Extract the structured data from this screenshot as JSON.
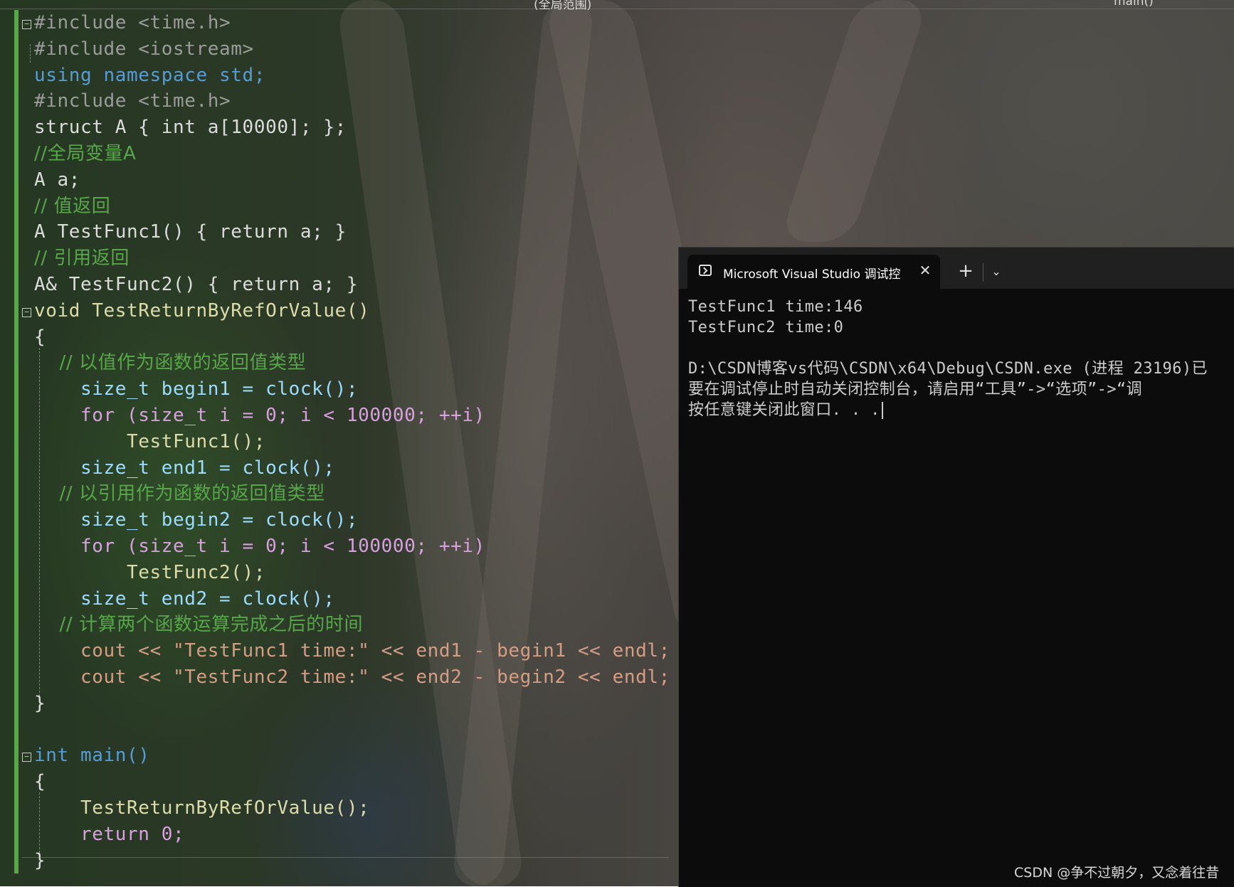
{
  "top_bar": {
    "scope_label": "(全局范围)",
    "function_label": "main()"
  },
  "editor": {
    "lines": [
      "#include <time.h>",
      "#include <iostream>",
      "using namespace std;",
      "#include <time.h>",
      "struct A { int a[10000]; };",
      "//全局变量A",
      "A a;",
      "// 值返回",
      "A TestFunc1() { return a; }",
      "// 引用返回",
      "A& TestFunc2() { return a; }",
      "void TestReturnByRefOrValue()",
      "{",
      "    // 以值作为函数的返回值类型",
      "    size_t begin1 = clock();",
      "    for (size_t i = 0; i < 100000; ++i)",
      "        TestFunc1();",
      "    size_t end1 = clock();",
      "    // 以引用作为函数的返回值类型",
      "    size_t begin2 = clock();",
      "    for (size_t i = 0; i < 100000; ++i)",
      "        TestFunc2();",
      "    size_t end2 = clock();",
      "    // 计算两个函数运算完成之后的时间",
      "    cout << \"TestFunc1 time:\" << end1 - begin1 << endl;",
      "    cout << \"TestFunc2 time:\" << end2 - begin2 << endl;",
      "}",
      "",
      "int main()",
      "{",
      "    TestReturnByRefOrValue();",
      "    return 0;",
      "}"
    ],
    "colors": {
      "keyword": "#569cd6",
      "control": "#d8a0df",
      "type": "#4ec9b0",
      "string": "#d69d85",
      "number": "#b5cea8",
      "comment": "#57a64a",
      "function": "#dcdcaa",
      "variable": "#9cdcfe",
      "text": "#dcdcdc",
      "include_path": "#e8a87c"
    }
  },
  "terminal": {
    "tab_title": "Microsoft Visual Studio 调试控制台",
    "close_icon": "close-icon",
    "new_tab_label": "+",
    "dropdown_icon": "chevron-down-icon",
    "output_lines": [
      "TestFunc1 time:146",
      "TestFunc2 time:0",
      "",
      "D:\\CSDN博客vs代码\\CSDN\\x64\\Debug\\CSDN.exe (进程 23196)已",
      "要在调试停止时自动关闭控制台，请启用“工具”->“选项”->“调",
      "按任意键关闭此窗口. . ."
    ],
    "background": "#0c0c0c",
    "text_color": "#cccccc"
  },
  "watermark": "CSDN @争不过朝夕，又念着往昔"
}
